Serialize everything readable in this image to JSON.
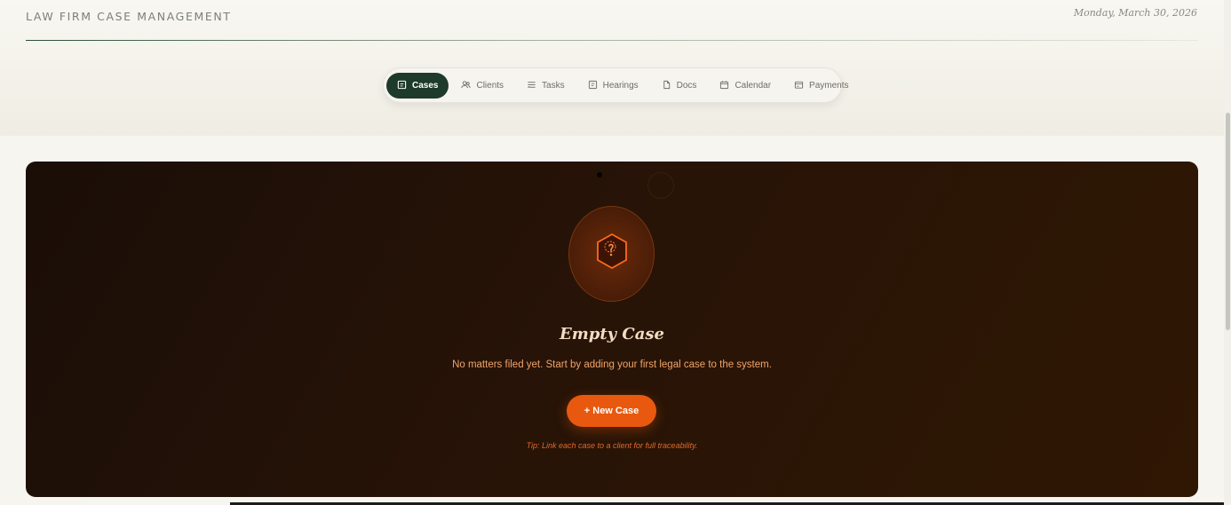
{
  "header": {
    "app_title": "LAW FIRM CASE MANAGEMENT",
    "date": "Monday, March 30, 2026"
  },
  "nav": {
    "tabs": [
      {
        "label": "Cases",
        "icon": "case-file-icon",
        "active": true
      },
      {
        "label": "Clients",
        "icon": "users-icon",
        "active": false
      },
      {
        "label": "Tasks",
        "icon": "task-list-icon",
        "active": false
      },
      {
        "label": "Hearings",
        "icon": "hearing-doc-icon",
        "active": false
      },
      {
        "label": "Docs",
        "icon": "document-icon",
        "active": false
      },
      {
        "label": "Calendar",
        "icon": "calendar-icon",
        "active": false
      },
      {
        "label": "Payments",
        "icon": "payment-card-icon",
        "active": false
      }
    ]
  },
  "empty_state": {
    "icon": "hexagon-question-icon",
    "title": "Empty Case",
    "description": "No matters filed yet. Start by adding your first legal case to the system.",
    "button_label": "+ New Case",
    "tip": "Tip: Link each case to a client for full traceability."
  },
  "colors": {
    "accent_green": "#1e3a2a",
    "accent_orange": "#e8590f",
    "panel_dark": "#271307"
  }
}
